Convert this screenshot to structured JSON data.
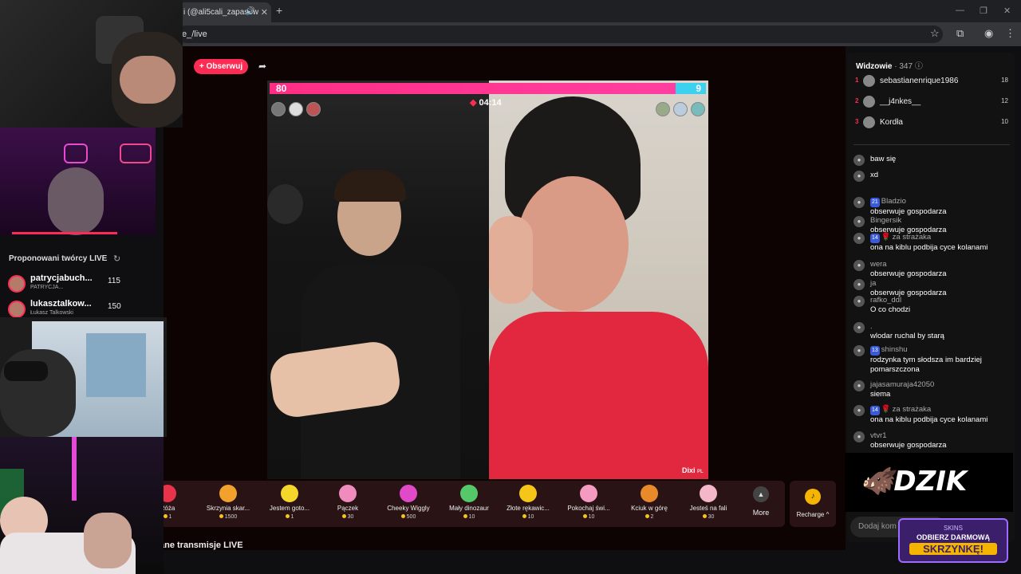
{
  "browser": {
    "tab_title": "i (@ali5cali_zapasow",
    "tab_close": "✕",
    "new_tab": "+",
    "address": "e_/live",
    "window_controls": [
      "—",
      "❐",
      "✕"
    ]
  },
  "stream": {
    "follow_label": "+ Obserwuj",
    "score_left": "80",
    "score_right": "9",
    "score_left_fraction": 0.93,
    "timer": "04:14",
    "creator_tag": "Dixi",
    "creator_tag_suffix": "PL"
  },
  "gifts": [
    {
      "name": "Róża",
      "price": "1"
    },
    {
      "name": "Skrzynia skar...",
      "price": "1500"
    },
    {
      "name": "Jestem goto...",
      "price": "1"
    },
    {
      "name": "Pączek",
      "price": "30"
    },
    {
      "name": "Cheeky Wiggly",
      "price": "500"
    },
    {
      "name": "Mały dinozaur",
      "price": "10"
    },
    {
      "name": "Złote rękawic...",
      "price": "10"
    },
    {
      "name": "Pokochaj świ...",
      "price": "10"
    },
    {
      "name": "Kciuk w górę",
      "price": "2"
    },
    {
      "name": "Jesteś na fali",
      "price": "30"
    }
  ],
  "more_label": "More",
  "recharge_label": "Recharge",
  "bottom_title": "ane transmisje LIVE",
  "viewers": {
    "title": "Widzowie",
    "count": "· 347",
    "top": [
      {
        "rank": "1",
        "name": "sebastianenrique1986",
        "score": "18"
      },
      {
        "rank": "2",
        "name": "__j4nkes__",
        "score": "12"
      },
      {
        "rank": "3",
        "name": "Kordła",
        "score": "10"
      }
    ]
  },
  "chat": [
    {
      "user": "",
      "text": "baw się",
      "badge": "",
      "sub": ""
    },
    {
      "user": "",
      "text": "xd",
      "badge": "",
      "sub": ""
    },
    {
      "user": "Bladzio",
      "text": "obserwuje gospodarza",
      "badge": "21",
      "sub": ""
    },
    {
      "user": "Bingersik",
      "text": "obserwuje gospodarza",
      "badge": "",
      "sub": ""
    },
    {
      "user": "za strażaka",
      "text": "ona na kiblu podbija cyce kolanami",
      "badge": "14",
      "sub": "🌹"
    },
    {
      "user": "wera",
      "text": "obserwuje gospodarza",
      "badge": "",
      "sub": ""
    },
    {
      "user": "ja",
      "text": "obserwuje gospodarza",
      "badge": "",
      "sub": ""
    },
    {
      "user": "rafko_ddl",
      "text": "O co chodzi",
      "badge": "",
      "sub": ""
    },
    {
      "user": ".",
      "text": "wlodar ruchal by starą",
      "badge": "",
      "sub": ""
    },
    {
      "user": "shinshu",
      "text": "rodzynka tym słodsza im bardziej pomarszczona",
      "badge": "13",
      "sub": ""
    },
    {
      "user": "jajasamuraja42050",
      "text": "siema",
      "badge": "",
      "sub": ""
    },
    {
      "user": "za strażaka",
      "text": "ona na kiblu podbija cyce kolanami",
      "badge": "14",
      "sub": "🌹"
    },
    {
      "user": "vtvr1",
      "text": "obserwuje gospodarza",
      "badge": "",
      "sub": ""
    }
  ],
  "comment_placeholder": "Dodaj kom",
  "sponsor": {
    "dzik": "DZIK",
    "skins_brand": "SKINS",
    "skins_line1": "ODBIERZ DARMOWĄ",
    "skins_line2": "SKRZYNKĘ!"
  },
  "suggestions": {
    "title": "Proponowani twórcy LIVE",
    "items": [
      {
        "name": "patrycjabuch...",
        "sub": "PATRYCJA...",
        "count": "115"
      },
      {
        "name": "lukasztalkow...",
        "sub": "Łukasz Talkowski",
        "count": "150"
      }
    ]
  }
}
